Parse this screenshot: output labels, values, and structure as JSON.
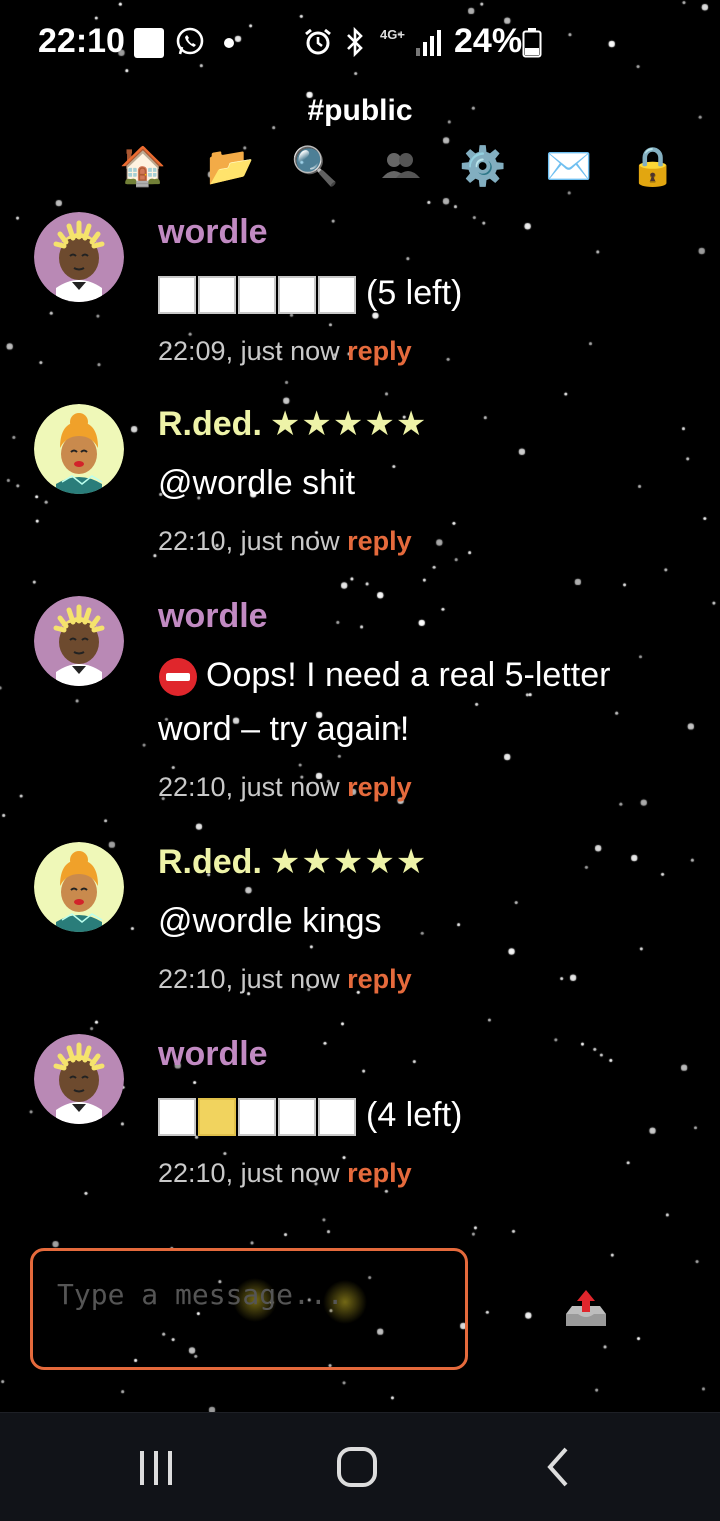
{
  "status_bar": {
    "time": "22:10",
    "network": "4G+",
    "battery": "24%",
    "icons": [
      "notification-square-icon",
      "whatsapp-icon",
      "alarm-icon",
      "bluetooth-icon",
      "signal-icon",
      "battery-icon"
    ]
  },
  "header": {
    "channel": "#public",
    "toolbar": [
      "home-icon",
      "folder-icon",
      "search-icon",
      "users-icon",
      "settings-icon",
      "mail-icon",
      "lock-icon"
    ]
  },
  "colors": {
    "background": "#000000",
    "bot_name": "#c18ac2",
    "user_name": "#eef3a8",
    "reply": "#e56a3c",
    "composer_border": "#e56a3c",
    "tile_yellow": "#f1d35e"
  },
  "messages": [
    {
      "author": "wordle",
      "tiles": [
        "white",
        "white",
        "white",
        "white",
        "white"
      ],
      "tiles_suffix": "(5 left)",
      "time": "22:09, just now",
      "reply": "reply"
    },
    {
      "author": "R.ded.",
      "badge": "★★★★★",
      "text": "@wordle shit",
      "time": "22:10, just now",
      "reply": "reply"
    },
    {
      "author": "wordle",
      "text": "Oops! I need a real 5-letter word – try again!",
      "time": "22:10, just now",
      "reply": "reply"
    },
    {
      "author": "R.ded.",
      "badge": "★★★★★",
      "text": "@wordle kings",
      "time": "22:10, just now",
      "reply": "reply"
    },
    {
      "author": "wordle",
      "tiles": [
        "white",
        "yellow",
        "white",
        "white",
        "white"
      ],
      "tiles_suffix": "(4 left)",
      "time": "22:10, just now",
      "reply": "reply"
    }
  ],
  "composer": {
    "placeholder": "Type a message...",
    "value": ""
  },
  "navbar": [
    "recent-apps-icon",
    "home-button-icon",
    "back-icon"
  ]
}
